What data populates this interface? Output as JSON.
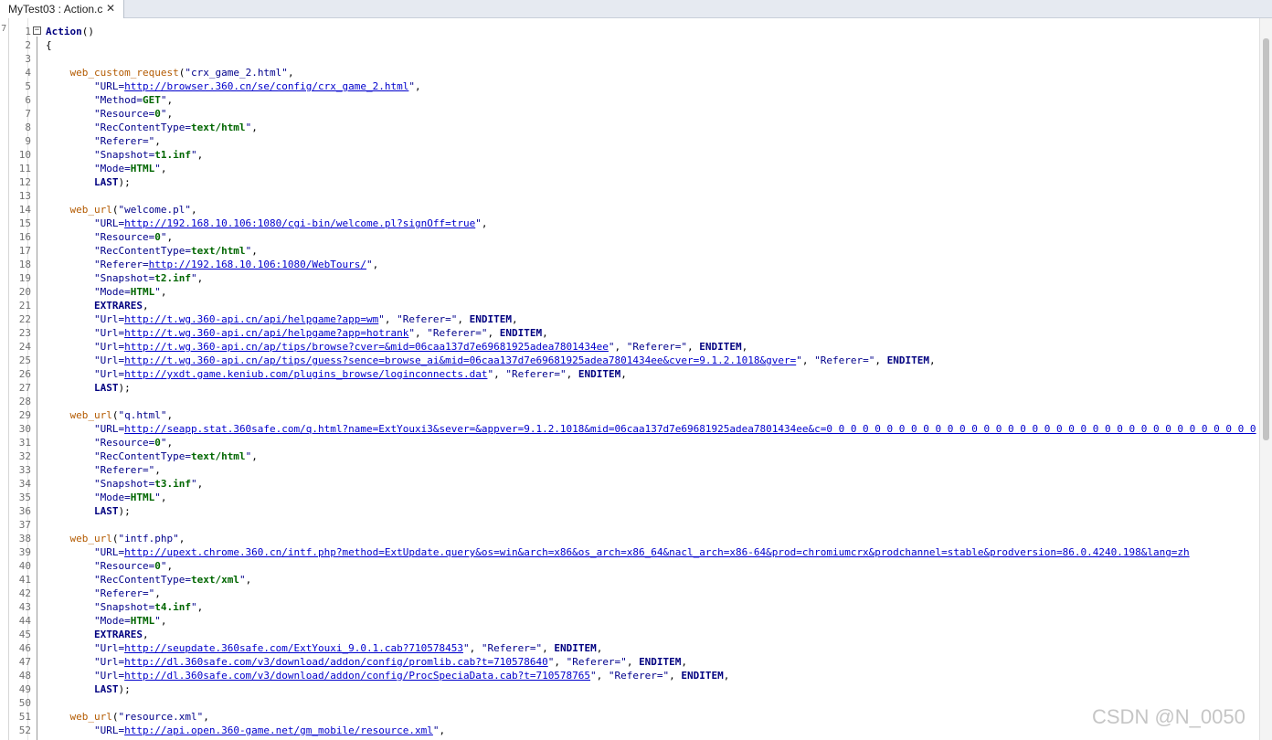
{
  "tab": {
    "title": "MyTest03 : Action.c",
    "close_icon": "close-icon"
  },
  "gutter_mark": "7",
  "watermark": "CSDN @N_0050",
  "lines": [
    [
      [
        "k",
        "Action"
      ],
      [
        "p",
        "()"
      ]
    ],
    [
      [
        "p",
        "{"
      ]
    ],
    [],
    [
      [
        "p",
        "    "
      ],
      [
        "fn",
        "web_custom_request"
      ],
      [
        "p",
        "("
      ],
      [
        "s",
        "\"crx_game_2.html\""
      ],
      [
        "p",
        ","
      ]
    ],
    [
      [
        "p",
        "        "
      ],
      [
        "s",
        "\"URL="
      ],
      [
        "u",
        "http://browser.360.cn/se/config/crx_game_2.html"
      ],
      [
        "s",
        "\""
      ],
      [
        "p",
        ","
      ]
    ],
    [
      [
        "p",
        "        "
      ],
      [
        "s",
        "\"Method="
      ],
      [
        "v",
        "GET"
      ],
      [
        "s",
        "\""
      ],
      [
        "p",
        ","
      ]
    ],
    [
      [
        "p",
        "        "
      ],
      [
        "s",
        "\"Resource="
      ],
      [
        "v",
        "0"
      ],
      [
        "s",
        "\""
      ],
      [
        "p",
        ","
      ]
    ],
    [
      [
        "p",
        "        "
      ],
      [
        "s",
        "\"RecContentType="
      ],
      [
        "v",
        "text/html"
      ],
      [
        "s",
        "\""
      ],
      [
        "p",
        ","
      ]
    ],
    [
      [
        "p",
        "        "
      ],
      [
        "s",
        "\"Referer=\""
      ],
      [
        "p",
        ","
      ]
    ],
    [
      [
        "p",
        "        "
      ],
      [
        "s",
        "\"Snapshot="
      ],
      [
        "v",
        "t1.inf"
      ],
      [
        "s",
        "\""
      ],
      [
        "p",
        ","
      ]
    ],
    [
      [
        "p",
        "        "
      ],
      [
        "s",
        "\"Mode="
      ],
      [
        "v",
        "HTML"
      ],
      [
        "s",
        "\""
      ],
      [
        "p",
        ","
      ]
    ],
    [
      [
        "p",
        "        "
      ],
      [
        "k",
        "LAST"
      ],
      [
        "p",
        ");"
      ]
    ],
    [],
    [
      [
        "p",
        "    "
      ],
      [
        "fn",
        "web_url"
      ],
      [
        "p",
        "("
      ],
      [
        "s",
        "\"welcome.pl\""
      ],
      [
        "p",
        ","
      ]
    ],
    [
      [
        "p",
        "        "
      ],
      [
        "s",
        "\"URL="
      ],
      [
        "u",
        "http://192.168.10.106:1080/cgi-bin/welcome.pl?signOff=true"
      ],
      [
        "s",
        "\""
      ],
      [
        "p",
        ","
      ]
    ],
    [
      [
        "p",
        "        "
      ],
      [
        "s",
        "\"Resource="
      ],
      [
        "v",
        "0"
      ],
      [
        "s",
        "\""
      ],
      [
        "p",
        ","
      ]
    ],
    [
      [
        "p",
        "        "
      ],
      [
        "s",
        "\"RecContentType="
      ],
      [
        "v",
        "text/html"
      ],
      [
        "s",
        "\""
      ],
      [
        "p",
        ","
      ]
    ],
    [
      [
        "p",
        "        "
      ],
      [
        "s",
        "\"Referer="
      ],
      [
        "u",
        "http://192.168.10.106:1080/WebTours/"
      ],
      [
        "s",
        "\""
      ],
      [
        "p",
        ","
      ]
    ],
    [
      [
        "p",
        "        "
      ],
      [
        "s",
        "\"Snapshot="
      ],
      [
        "v",
        "t2.inf"
      ],
      [
        "s",
        "\""
      ],
      [
        "p",
        ","
      ]
    ],
    [
      [
        "p",
        "        "
      ],
      [
        "s",
        "\"Mode="
      ],
      [
        "v",
        "HTML"
      ],
      [
        "s",
        "\""
      ],
      [
        "p",
        ","
      ]
    ],
    [
      [
        "p",
        "        "
      ],
      [
        "k",
        "EXTRARES"
      ],
      [
        "p",
        ","
      ]
    ],
    [
      [
        "p",
        "        "
      ],
      [
        "s",
        "\"Url="
      ],
      [
        "u",
        "http://t.wg.360-api.cn/api/helpgame?app=wm"
      ],
      [
        "s",
        "\""
      ],
      [
        "p",
        ", "
      ],
      [
        "s",
        "\"Referer=\""
      ],
      [
        "p",
        ", "
      ],
      [
        "k",
        "ENDITEM"
      ],
      [
        "p",
        ","
      ]
    ],
    [
      [
        "p",
        "        "
      ],
      [
        "s",
        "\"Url="
      ],
      [
        "u",
        "http://t.wg.360-api.cn/api/helpgame?app=hotrank"
      ],
      [
        "s",
        "\""
      ],
      [
        "p",
        ", "
      ],
      [
        "s",
        "\"Referer=\""
      ],
      [
        "p",
        ", "
      ],
      [
        "k",
        "ENDITEM"
      ],
      [
        "p",
        ","
      ]
    ],
    [
      [
        "p",
        "        "
      ],
      [
        "s",
        "\"Url="
      ],
      [
        "u",
        "http://t.wg.360-api.cn/ap/tips/browse?cver=&mid=06caa137d7e69681925adea7801434ee"
      ],
      [
        "s",
        "\""
      ],
      [
        "p",
        ", "
      ],
      [
        "s",
        "\"Referer=\""
      ],
      [
        "p",
        ", "
      ],
      [
        "k",
        "ENDITEM"
      ],
      [
        "p",
        ","
      ]
    ],
    [
      [
        "p",
        "        "
      ],
      [
        "s",
        "\"Url="
      ],
      [
        "u",
        "http://t.wg.360-api.cn/ap/tips/guess?sence=browse_ai&mid=06caa137d7e69681925adea7801434ee&cver=9.1.2.1018&gver="
      ],
      [
        "s",
        "\""
      ],
      [
        "p",
        ", "
      ],
      [
        "s",
        "\"Referer=\""
      ],
      [
        "p",
        ", "
      ],
      [
        "k",
        "ENDITEM"
      ],
      [
        "p",
        ","
      ]
    ],
    [
      [
        "p",
        "        "
      ],
      [
        "s",
        "\"Url="
      ],
      [
        "u",
        "http://yxdt.game.keniub.com/plugins_browse/loginconnects.dat"
      ],
      [
        "s",
        "\""
      ],
      [
        "p",
        ", "
      ],
      [
        "s",
        "\"Referer=\""
      ],
      [
        "p",
        ", "
      ],
      [
        "k",
        "ENDITEM"
      ],
      [
        "p",
        ","
      ]
    ],
    [
      [
        "p",
        "        "
      ],
      [
        "k",
        "LAST"
      ],
      [
        "p",
        ");"
      ]
    ],
    [],
    [
      [
        "p",
        "    "
      ],
      [
        "fn",
        "web_url"
      ],
      [
        "p",
        "("
      ],
      [
        "s",
        "\"q.html\""
      ],
      [
        "p",
        ","
      ]
    ],
    [
      [
        "p",
        "        "
      ],
      [
        "s",
        "\"URL="
      ],
      [
        "u",
        "http://seapp.stat.360safe.com/q.html?name=ExtYouxi3&sever=&appver=9.1.2.1018&mid=06caa137d7e69681925adea7801434ee&c=0 0 0 0 0 0 0 0 0 0 0 0 0 0 0 0 0 0 0 0 0 0 0 0 0 0 0 0 0 0 0 0 0 0 0 0"
      ]
    ],
    [
      [
        "p",
        "        "
      ],
      [
        "s",
        "\"Resource="
      ],
      [
        "v",
        "0"
      ],
      [
        "s",
        "\""
      ],
      [
        "p",
        ","
      ]
    ],
    [
      [
        "p",
        "        "
      ],
      [
        "s",
        "\"RecContentType="
      ],
      [
        "v",
        "text/html"
      ],
      [
        "s",
        "\""
      ],
      [
        "p",
        ","
      ]
    ],
    [
      [
        "p",
        "        "
      ],
      [
        "s",
        "\"Referer=\""
      ],
      [
        "p",
        ","
      ]
    ],
    [
      [
        "p",
        "        "
      ],
      [
        "s",
        "\"Snapshot="
      ],
      [
        "v",
        "t3.inf"
      ],
      [
        "s",
        "\""
      ],
      [
        "p",
        ","
      ]
    ],
    [
      [
        "p",
        "        "
      ],
      [
        "s",
        "\"Mode="
      ],
      [
        "v",
        "HTML"
      ],
      [
        "s",
        "\""
      ],
      [
        "p",
        ","
      ]
    ],
    [
      [
        "p",
        "        "
      ],
      [
        "k",
        "LAST"
      ],
      [
        "p",
        ");"
      ]
    ],
    [],
    [
      [
        "p",
        "    "
      ],
      [
        "fn",
        "web_url"
      ],
      [
        "p",
        "("
      ],
      [
        "s",
        "\"intf.php\""
      ],
      [
        "p",
        ","
      ]
    ],
    [
      [
        "p",
        "        "
      ],
      [
        "s",
        "\"URL="
      ],
      [
        "u",
        "http://upext.chrome.360.cn/intf.php?method=ExtUpdate.query&os=win&arch=x86&os_arch=x86_64&nacl_arch=x86-64&prod=chromiumcrx&prodchannel=stable&prodversion=86.0.4240.198&lang=zh"
      ]
    ],
    [
      [
        "p",
        "        "
      ],
      [
        "s",
        "\"Resource="
      ],
      [
        "v",
        "0"
      ],
      [
        "s",
        "\""
      ],
      [
        "p",
        ","
      ]
    ],
    [
      [
        "p",
        "        "
      ],
      [
        "s",
        "\"RecContentType="
      ],
      [
        "v",
        "text/xml"
      ],
      [
        "s",
        "\""
      ],
      [
        "p",
        ","
      ]
    ],
    [
      [
        "p",
        "        "
      ],
      [
        "s",
        "\"Referer=\""
      ],
      [
        "p",
        ","
      ]
    ],
    [
      [
        "p",
        "        "
      ],
      [
        "s",
        "\"Snapshot="
      ],
      [
        "v",
        "t4.inf"
      ],
      [
        "s",
        "\""
      ],
      [
        "p",
        ","
      ]
    ],
    [
      [
        "p",
        "        "
      ],
      [
        "s",
        "\"Mode="
      ],
      [
        "v",
        "HTML"
      ],
      [
        "s",
        "\""
      ],
      [
        "p",
        ","
      ]
    ],
    [
      [
        "p",
        "        "
      ],
      [
        "k",
        "EXTRARES"
      ],
      [
        "p",
        ","
      ]
    ],
    [
      [
        "p",
        "        "
      ],
      [
        "s",
        "\"Url="
      ],
      [
        "u",
        "http://seupdate.360safe.com/ExtYouxi_9.0.1.cab?710578453"
      ],
      [
        "s",
        "\""
      ],
      [
        "p",
        ", "
      ],
      [
        "s",
        "\"Referer=\""
      ],
      [
        "p",
        ", "
      ],
      [
        "k",
        "ENDITEM"
      ],
      [
        "p",
        ","
      ]
    ],
    [
      [
        "p",
        "        "
      ],
      [
        "s",
        "\"Url="
      ],
      [
        "u",
        "http://dl.360safe.com/v3/download/addon/config/promlib.cab?t=710578640"
      ],
      [
        "s",
        "\""
      ],
      [
        "p",
        ", "
      ],
      [
        "s",
        "\"Referer=\""
      ],
      [
        "p",
        ", "
      ],
      [
        "k",
        "ENDITEM"
      ],
      [
        "p",
        ","
      ]
    ],
    [
      [
        "p",
        "        "
      ],
      [
        "s",
        "\"Url="
      ],
      [
        "u",
        "http://dl.360safe.com/v3/download/addon/config/ProcSpeciaData.cab?t=710578765"
      ],
      [
        "s",
        "\""
      ],
      [
        "p",
        ", "
      ],
      [
        "s",
        "\"Referer=\""
      ],
      [
        "p",
        ", "
      ],
      [
        "k",
        "ENDITEM"
      ],
      [
        "p",
        ","
      ]
    ],
    [
      [
        "p",
        "        "
      ],
      [
        "k",
        "LAST"
      ],
      [
        "p",
        ");"
      ]
    ],
    [],
    [
      [
        "p",
        "    "
      ],
      [
        "fn",
        "web_url"
      ],
      [
        "p",
        "("
      ],
      [
        "s",
        "\"resource.xml\""
      ],
      [
        "p",
        ","
      ]
    ],
    [
      [
        "p",
        "        "
      ],
      [
        "s",
        "\"URL="
      ],
      [
        "u",
        "http://api.open.360-game.net/gm_mobile/resource.xml"
      ],
      [
        "s",
        "\""
      ],
      [
        "p",
        ","
      ]
    ]
  ]
}
